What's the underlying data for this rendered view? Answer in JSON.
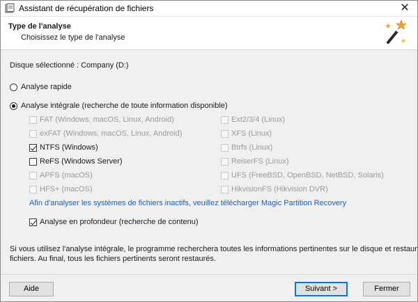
{
  "window": {
    "title": "Assistant de récupération de fichiers",
    "close_label": "✕"
  },
  "header": {
    "title": "Type de l'analyse",
    "subtitle": "Choisissez le type de l'analyse"
  },
  "disk": {
    "label": "Disque sélectionné : Company (D:)"
  },
  "scan_options": {
    "quick": {
      "label": "Analyse rapide",
      "selected": false
    },
    "full": {
      "label": "Analyse intégrale (recherche de toute information disponible)",
      "selected": true
    }
  },
  "filesystems_left": [
    {
      "label": "FAT (Windows, macOS, Linux, Android)",
      "checked": false,
      "enabled": false
    },
    {
      "label": "exFAT (Windows, macOS, Linux, Android)",
      "checked": false,
      "enabled": false
    },
    {
      "label": "NTFS (Windows)",
      "checked": true,
      "enabled": true
    },
    {
      "label": "ReFS (Windows Server)",
      "checked": false,
      "enabled": true
    },
    {
      "label": "APFS (macOS)",
      "checked": false,
      "enabled": false
    },
    {
      "label": "HFS+ (macOS)",
      "checked": false,
      "enabled": false
    }
  ],
  "filesystems_right": [
    {
      "label": "Ext2/3/4 (Linux)",
      "checked": false,
      "enabled": false
    },
    {
      "label": "XFS (Linux)",
      "checked": false,
      "enabled": false
    },
    {
      "label": "Btrfs (Linux)",
      "checked": false,
      "enabled": false
    },
    {
      "label": "ReiserFS (Linux)",
      "checked": false,
      "enabled": false
    },
    {
      "label": "UFS (FreeBSD, OpenBSD, NetBSD, Solaris)",
      "checked": false,
      "enabled": false
    },
    {
      "label": "HikvisionFS (Hikvision DVR)",
      "checked": false,
      "enabled": false
    }
  ],
  "inactive_fs_link": "Afin d'analyser les systèmes de fichiers inactifs, veuillez télécharger Magic Partition Recovery",
  "deep_scan": {
    "label": "Analyse en profondeur (recherche de contenu)",
    "checked": true
  },
  "info": {
    "line1": "Si vous utilisez l'analyse intégrale, le programme recherchera toutes les informations pertinentes sur le disque et restaurera le système de",
    "line2": "fichiers. Au final, tous les fichiers pertinents seront restaurés."
  },
  "buttons": {
    "help": "Aide",
    "next": "Suivant >",
    "close": "Fermer"
  },
  "colors": {
    "link": "#1a5fb4",
    "primary_border": "#0078d7",
    "disabled_text": "#9a9a9a"
  },
  "icons": {
    "app": "app-icon",
    "wizard": "magic-wand-icon",
    "close": "close-icon"
  }
}
